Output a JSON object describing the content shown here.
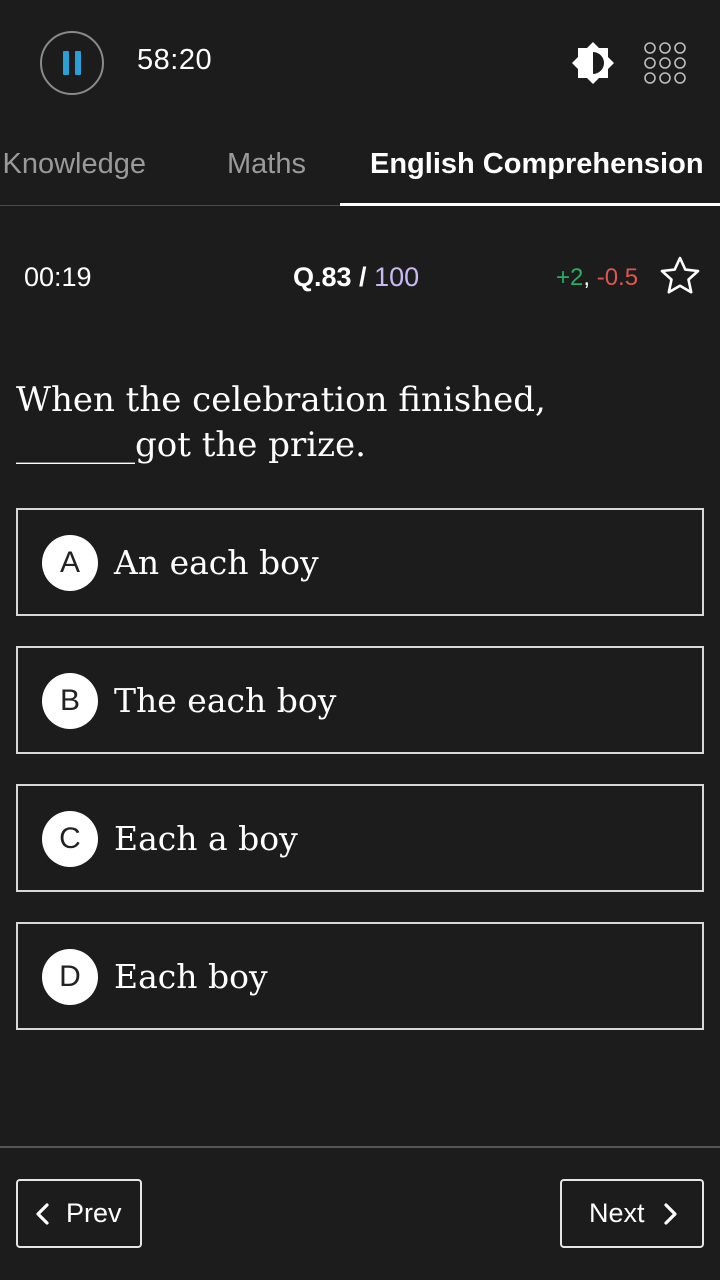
{
  "header": {
    "timer": "58:20",
    "accent_color": "#2a9fd6"
  },
  "tabs": [
    {
      "label": "l Knowledge",
      "active": false
    },
    {
      "label": "Maths",
      "active": false
    },
    {
      "label": "English Comprehension",
      "active": true
    }
  ],
  "question_info": {
    "elapsed": "00:19",
    "number": "Q.83 /",
    "total": "100",
    "marks_positive": "+2",
    "marks_separator": ",",
    "marks_negative": "-0.5",
    "positive_color": "#27ae60",
    "negative_color": "#e0554d"
  },
  "question": {
    "text": "When the celebration finished, _______got the prize."
  },
  "options": [
    {
      "letter": "A",
      "text": "An each boy"
    },
    {
      "letter": "B",
      "text": "The each boy"
    },
    {
      "letter": "C",
      "text": "Each a boy"
    },
    {
      "letter": "D",
      "text": "Each boy"
    }
  ],
  "footer": {
    "prev_label": "Prev",
    "next_label": "Next"
  }
}
